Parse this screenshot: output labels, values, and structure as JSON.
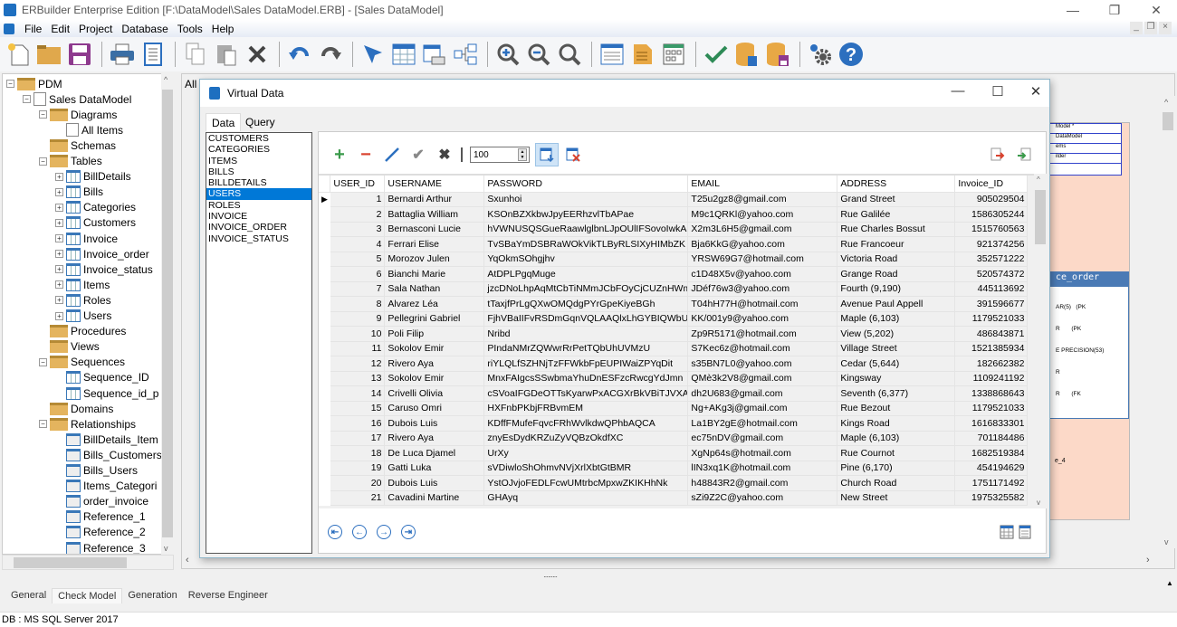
{
  "window": {
    "title": "ERBuilder Enterprise Edition [F:\\DataModel\\Sales DataModel.ERB] - [Sales DataModel]",
    "minimize": "—",
    "maximize": "❐",
    "close": "✕"
  },
  "menu": [
    "File",
    "Edit",
    "Project",
    "Database",
    "Tools",
    "Help"
  ],
  "toolbar": [
    "new-icon",
    "open-icon",
    "save-icon",
    "print-icon",
    "report-icon",
    "copy-icon",
    "paste-icon",
    "delete-icon",
    "undo-icon",
    "redo-icon",
    "select-icon",
    "table-icon",
    "relationship-icon",
    "hierarchy-icon",
    "zoom-in-icon",
    "zoom-out-icon",
    "zoom-fit-icon",
    "note-icon",
    "document-icon",
    "layout-icon",
    "check-model-icon",
    "generate-db-icon",
    "save-db-icon",
    "settings-icon",
    "help-icon"
  ],
  "tree": {
    "nodes": [
      {
        "label": "PDM",
        "level": 0,
        "icon": "folder",
        "expander": "−"
      },
      {
        "label": "Sales DataModel",
        "level": 1,
        "icon": "doc",
        "expander": "−"
      },
      {
        "label": "Diagrams",
        "level": 2,
        "icon": "folder",
        "expander": "−"
      },
      {
        "label": "All Items",
        "level": 3,
        "icon": "doc",
        "expander": ""
      },
      {
        "label": "Schemas",
        "level": 2,
        "icon": "folder",
        "expander": ""
      },
      {
        "label": "Tables",
        "level": 2,
        "icon": "folder",
        "expander": "−"
      },
      {
        "label": "BillDetails",
        "level": 3,
        "icon": "table",
        "expander": "+"
      },
      {
        "label": "Bills",
        "level": 3,
        "icon": "table",
        "expander": "+"
      },
      {
        "label": "Categories",
        "level": 3,
        "icon": "table",
        "expander": "+"
      },
      {
        "label": "Customers",
        "level": 3,
        "icon": "table",
        "expander": "+"
      },
      {
        "label": "Invoice",
        "level": 3,
        "icon": "table",
        "expander": "+"
      },
      {
        "label": "Invoice_order",
        "level": 3,
        "icon": "table",
        "expander": "+"
      },
      {
        "label": "Invoice_status",
        "level": 3,
        "icon": "table",
        "expander": "+"
      },
      {
        "label": "Items",
        "level": 3,
        "icon": "table",
        "expander": "+"
      },
      {
        "label": "Roles",
        "level": 3,
        "icon": "table",
        "expander": "+"
      },
      {
        "label": "Users",
        "level": 3,
        "icon": "table",
        "expander": "+"
      },
      {
        "label": "Procedures",
        "level": 2,
        "icon": "folder",
        "expander": ""
      },
      {
        "label": "Views",
        "level": 2,
        "icon": "folder",
        "expander": ""
      },
      {
        "label": "Sequences",
        "level": 2,
        "icon": "folder",
        "expander": "−"
      },
      {
        "label": "Sequence_ID",
        "level": 3,
        "icon": "table",
        "expander": ""
      },
      {
        "label": "Sequence_id_p",
        "level": 3,
        "icon": "table",
        "expander": ""
      },
      {
        "label": "Domains",
        "level": 2,
        "icon": "folder",
        "expander": ""
      },
      {
        "label": "Relationships",
        "level": 2,
        "icon": "folder",
        "expander": "−"
      },
      {
        "label": "BillDetails_Item",
        "level": 3,
        "icon": "rel",
        "expander": ""
      },
      {
        "label": "Bills_Customers",
        "level": 3,
        "icon": "rel",
        "expander": ""
      },
      {
        "label": "Bills_Users",
        "level": 3,
        "icon": "rel",
        "expander": ""
      },
      {
        "label": "Items_Categori",
        "level": 3,
        "icon": "rel",
        "expander": ""
      },
      {
        "label": "order_invoice",
        "level": 3,
        "icon": "rel",
        "expander": ""
      },
      {
        "label": "Reference_1",
        "level": 3,
        "icon": "rel",
        "expander": ""
      },
      {
        "label": "Reference_2",
        "level": 3,
        "icon": "rel",
        "expander": ""
      },
      {
        "label": "Reference_3",
        "level": 3,
        "icon": "rel",
        "expander": ""
      }
    ]
  },
  "canvas": {
    "tab_label": "All",
    "diagram_box_lines": [
      "Model *",
      "DataModel",
      "ems",
      "ilder"
    ],
    "entity_title": "ce_order",
    "entity_rows": [
      "AR(5)   (PK",
      "R       (PK",
      "E PRECISION(53)",
      "R",
      "R       (FK"
    ],
    "ref_label": "e_4"
  },
  "dialog": {
    "title": "Virtual Data",
    "tabs": [
      "Data",
      "Query"
    ],
    "tables": [
      "CUSTOMERS",
      "CATEGORIES",
      "ITEMS",
      "BILLS",
      "BILLDETAILS",
      "USERS",
      "ROLES",
      "INVOICE",
      "INVOICE_ORDER",
      "INVOICE_STATUS"
    ],
    "selected_table": "USERS",
    "row_limit": "100",
    "columns": [
      "USER_ID",
      "USERNAME",
      "PASSWORD",
      "EMAIL",
      "ADDRESS",
      "Invoice_ID"
    ],
    "rows": [
      [
        "1",
        "Bernardi Arthur",
        "Sxunhoi",
        "T25u2gz8@gmail.com",
        "Grand Street",
        "905029504"
      ],
      [
        "2",
        "Battaglia William",
        "KSOnBZXkbwJpyEERhzvlTbAPae",
        "M9c1QRKl@yahoo.com",
        "Rue Galilée",
        "1586305244"
      ],
      [
        "3",
        "Bernasconi Lucie",
        "hVWNUSQSGueRaawlglbnLJpOUlIFSovoIwkAiEa",
        "X2m3L6H5@gmail.com",
        "Rue Charles Bossut",
        "1515760563"
      ],
      [
        "4",
        "Ferrari Elise",
        "TvSBaYmDSBRaWOkVikTLByRLSIXyHIMbZK",
        "Bja6KkG@yahoo.com",
        "Rue Francoeur",
        "921374256"
      ],
      [
        "5",
        "Morozov Julen",
        "YqOkmSOhgjhv",
        "YRSW69G7@hotmail.com",
        "Victoria Road",
        "352571222"
      ],
      [
        "6",
        "Bianchi Marie",
        "AtDPLPgqMuge",
        "c1D48X5v@yahoo.com",
        "Grange Road",
        "520574372"
      ],
      [
        "7",
        "Sala Nathan",
        "jzcDNoLhpAqMtCbTiNMmJCbFOyCjCUZnHWmTN",
        "JDéf76w3@yahoo.com",
        "Fourth (9,190)",
        "445113692"
      ],
      [
        "8",
        "Alvarez Léa",
        "tTaxjfPrLgQXwOMQdgPYrGpeKiyeBGh",
        "T04hH77H@hotmail.com",
        "Avenue Paul Appell",
        "391596677"
      ],
      [
        "9",
        "Pellegrini Gabriel",
        "FjhVBaIIFvRSDmGqnVQLAAQlxLhGYBIQWbU",
        "KK/001y9@yahoo.com",
        "Maple (6,103)",
        "1179521033"
      ],
      [
        "10",
        "Poli Filip",
        "Nribd",
        "Zp9R5171@hotmail.com",
        "View (5,202)",
        "486843871"
      ],
      [
        "11",
        "Sokolov Emir",
        "PIndaNMrZQWwrRrPetTQbUhUVMzU",
        "S7Kec6z@hotmail.com",
        "Village Street",
        "1521385934"
      ],
      [
        "12",
        "Rivero Aya",
        "riYLQLfSZHNjTzFFWkbFpEUPIWaiZPYqDit",
        "s35BN7L0@yahoo.com",
        "Cedar (5,644)",
        "182662382"
      ],
      [
        "13",
        "Sokolov Emir",
        "MnxFAIgcsSSwbmaYhuDnESFzcRwcgYdJmn",
        "QMè3k2V8@gmail.com",
        "Kingsway",
        "1109241192"
      ],
      [
        "14",
        "Crivelli Olivia",
        "cSVoaIFGDeOTTsKyarwPxACGXrBkVBiTJVXA",
        "dh2U683@gmail.com",
        "Seventh (6,377)",
        "1338868643"
      ],
      [
        "15",
        "Caruso Omri",
        "HXFnbPKbjFRBvmEM",
        "Ng+AKg3j@gmail.com",
        "Rue Bezout",
        "1179521033"
      ],
      [
        "16",
        "Dubois Luis",
        "KDffFMufeFqvcFRhWvlkdwQPhbAQCA",
        "La1BY2gE@hotmail.com",
        "Kings Road",
        "1616833301"
      ],
      [
        "17",
        "Rivero Aya",
        "znyEsDydKRZuZyVQBzOkdfXC",
        "ec75nDV@gmail.com",
        "Maple (6,103)",
        "701184486"
      ],
      [
        "18",
        "De Luca Djamel",
        "UrXy",
        "XgNp64s@hotmail.com",
        "Rue Cournot",
        "1682519384"
      ],
      [
        "19",
        "Gatti Luka",
        "sVDiwloShOhmvNVjXrlXbtGtBMR",
        "lIN3xq1K@hotmail.com",
        "Pine (6,170)",
        "454194629"
      ],
      [
        "20",
        "Dubois Luis",
        "YstOJvjoFEDLFcwUMtrbcMpxwZKIKHhNk",
        "h48843R2@gmail.com",
        "Church Road",
        "1751171492"
      ],
      [
        "21",
        "Cavadini Martine",
        "GHAyq",
        "sZi9Z2C@yahoo.com",
        "New Street",
        "1975325582"
      ]
    ],
    "nav": {
      "first": "⇤",
      "prev": "←",
      "next": "→",
      "last": "⇥"
    }
  },
  "bottom_tabs": [
    "General",
    "Check Model",
    "Generation",
    "Reverse Engineer"
  ],
  "active_bottom_tab": "Check Model",
  "status": "DB : MS SQL Server 2017"
}
